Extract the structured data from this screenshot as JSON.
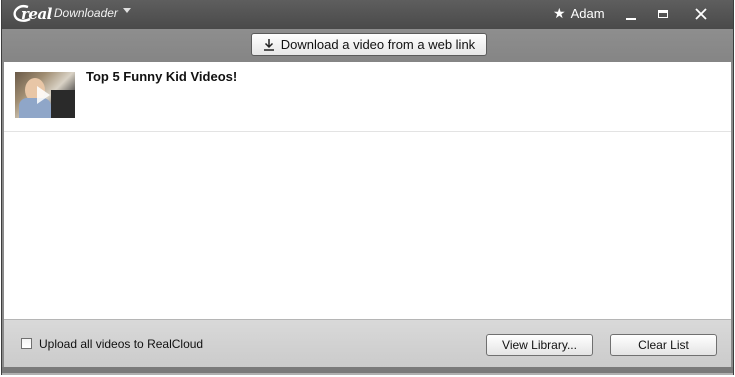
{
  "app": {
    "logo_real": "real",
    "logo_downloader": "Downloader"
  },
  "titlebar": {
    "user_name": "Adam",
    "star_icon": "star-icon",
    "minimize_icon": "minimize-icon",
    "maximize_icon": "maximize-icon",
    "close_icon": "close-icon"
  },
  "toolbar": {
    "download_link_label": "Download a video from a web link",
    "download_icon": "download-icon"
  },
  "list": {
    "items": [
      {
        "title": "Top 5 Funny Kid Videos!",
        "thumbnail_icon": "play-icon"
      }
    ]
  },
  "footer": {
    "upload_checkbox_label": "Upload all videos to RealCloud",
    "upload_checked": false,
    "view_library_label": "View Library...",
    "clear_list_label": "Clear List"
  },
  "colors": {
    "titlebar": "#4f4f4f",
    "toolbar": "#8a8a8a",
    "footer": "#d2d2d2"
  }
}
